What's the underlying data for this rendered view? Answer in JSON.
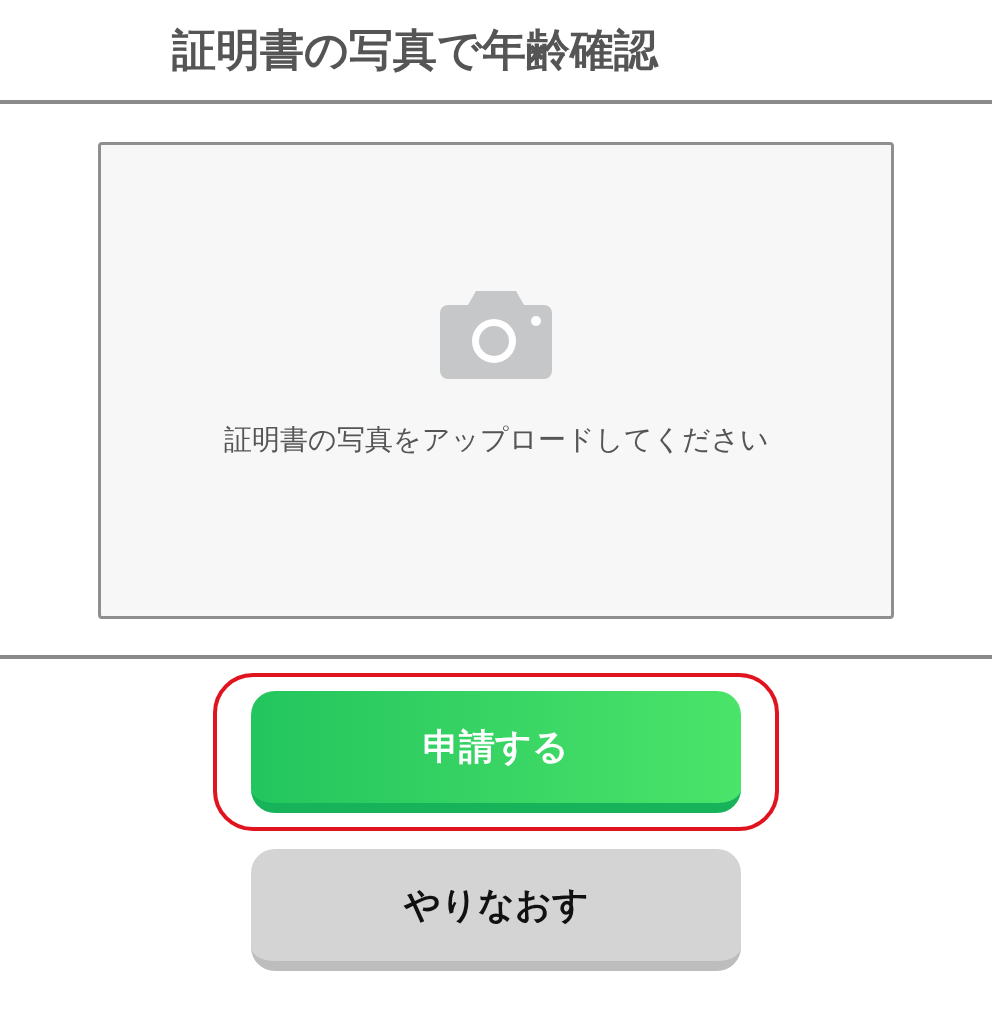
{
  "title": "証明書の写真で年齢確認",
  "upload": {
    "prompt": "証明書の写真をアップロードしてください"
  },
  "buttons": [
    {
      "label": "申請する",
      "kind": "primary",
      "highlighted": true
    },
    {
      "label": "やりなおす",
      "kind": "secondary",
      "highlighted": false
    }
  ]
}
